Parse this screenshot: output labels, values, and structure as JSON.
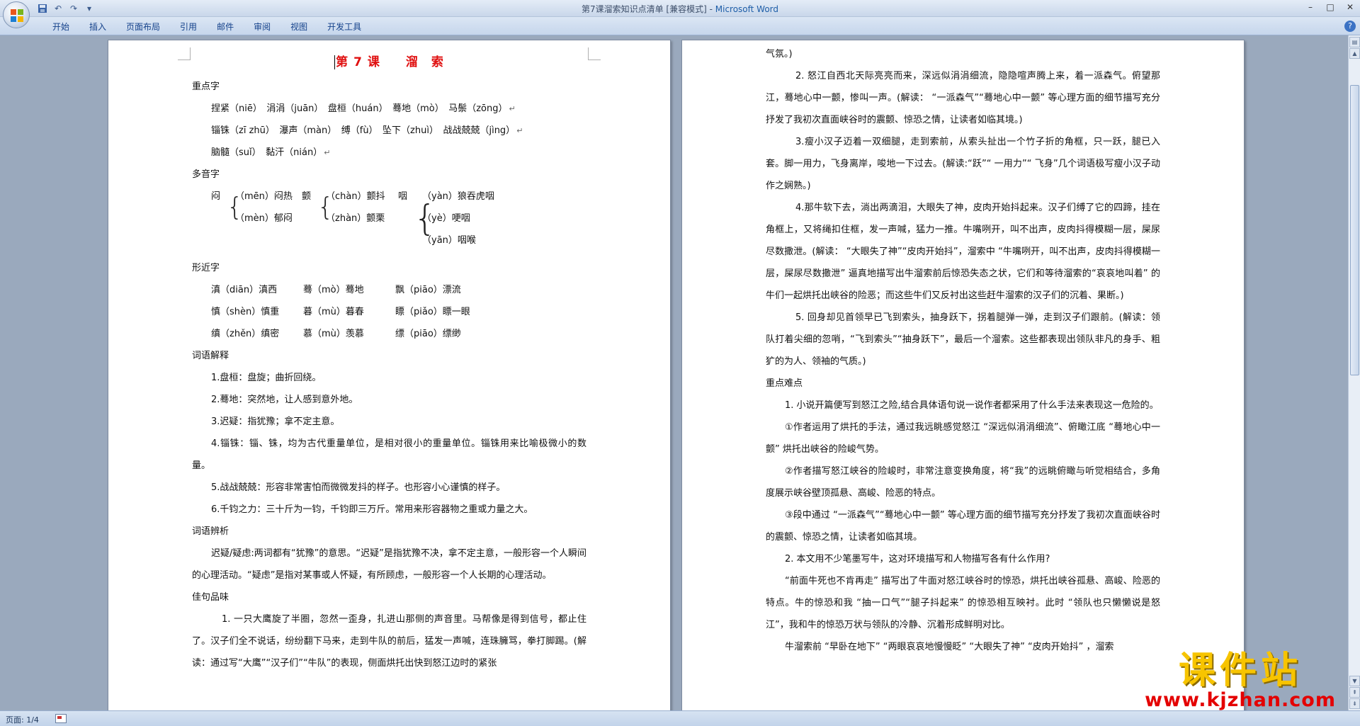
{
  "window": {
    "title_doc": "第7课溜索知识点清单 [兼容模式] - ",
    "title_app": "Microsoft Word"
  },
  "ribbon": {
    "tabs": [
      "开始",
      "插入",
      "页面布局",
      "引用",
      "邮件",
      "审阅",
      "视图",
      "开发工具"
    ]
  },
  "status": {
    "page": "页面: 1/4"
  },
  "watermark": {
    "cn": "课件站",
    "url": "www.kjzhan.com"
  },
  "page1": {
    "title": "第 7 课　　溜　索",
    "zhongdianzi_heading": "重点字",
    "zhongdianzi_lines": [
      "捏紧（niē）　涓涓（juān）　盘桓（huán）　蓦地（mò）　马鬃（zōng）",
      "锱铢（zī zhū）　瀑声（màn）　缚（fù）　坠下（zhuì）　战战兢兢（jìng）",
      "脑髓（suǐ）　黏汗（nián）"
    ],
    "duoyinzi_heading": "多音字",
    "duoyin": [
      {
        "ch": "闷",
        "items": [
          "（mēn）闷热",
          "（mèn）郁闷"
        ]
      },
      {
        "ch": "颤",
        "items": [
          "（chàn）颤抖",
          "（zhàn）颤栗"
        ]
      },
      {
        "ch": "咽",
        "items": [
          "（yàn）狼吞虎咽",
          "（yè）哽咽",
          "（yān）咽喉"
        ]
      }
    ],
    "xingjinzi_heading": "形近字",
    "xingjin_rows": [
      [
        "滇（diān）滇西",
        "蓦（mò）蓦地",
        "飘（piāo）漂流"
      ],
      [
        "慎（shèn）慎重",
        "暮（mù）暮春",
        "瞟（piǎo）瞟一眼"
      ],
      [
        "缜（zhěn）缜密",
        "慕（mù）羡慕",
        "缥（piāo）缥缈"
      ]
    ],
    "ciyu_heading": "词语解释",
    "ciyu_items": [
      "1.盘桓：盘旋；曲折回绕。",
      "2.蓦地：突然地，让人感到意外地。",
      "3.迟疑：指犹豫；拿不定主意。",
      "4.锱铢：锱、铢，均为古代重量单位，是相对很小的重量单位。锱铢用来比喻极微小的数量。",
      "5.战战兢兢：形容非常害怕而微微发抖的样子。也形容小心谨慎的样子。",
      "6.千钧之力：三十斤为一钧，千钧即三万斤。常用来形容器物之重或力量之大。"
    ],
    "bianxi_heading": "词语辨析",
    "bianxi_text": "迟疑/疑虑:两词都有“犹豫”的意思。“迟疑”是指犹豫不决，拿不定主意，一般形容一个人瞬间的心理活动。“疑虑”是指对某事或人怀疑，有所顾虑，一般形容一个人长期的心理活动。",
    "jiaju_heading": "佳句品味",
    "jiaju_text": "1. 一只大鹰旋了半圈，忽然一歪身，扎进山那侧的声音里。马帮像是得到信号，都止住了。汉子们全不说话，纷纷翻下马来，走到牛队的前后，猛发一声喊，连珠臃骂，拳打脚踢。(解读：通过写“大鹰”“汉子们”“牛队”的表现，侧面烘托出快到怒江边时的紧张"
  },
  "page2": {
    "lead": "气氛。)",
    "paras": [
      "2. 怒江自西北天际亮亮而来，深远似涓涓细流，隐隐喧声腾上来，着一派森气。俯望那江，蓦地心中一颤，惨叫一声。(解读： “一派森气”“蓦地心中一颤” 等心理方面的细节描写充分抒发了我初次直面峡谷时的震颤、惊恐之情，让读者如临其境。)",
      "3.瘦小汉子迈着一双细腿，走到索前，从索头扯出一个竹子折的角框，只一跃，腿已入套。脚一用力，飞身离岸，唆地一下过去。(解读:“跃”“ 一用力”“ 飞身”几个词语极写瘦小汉子动作之娴熟。)",
      "4.那牛软下去，淌出两滴泪，大眼失了神，皮肉开始抖起来。汉子们缚了它的四蹄，挂在角框上，又将绳扣住框，发一声喊，猛力一推。牛嘴咧开，叫不出声，皮肉抖得模糊一层，屎尿尽数撒泄。(解读： “大眼失了神”“皮肉开始抖”，溜索中 “牛嘴咧开，叫不出声，皮肉抖得模糊一层，屎尿尽数撒泄” 逼真地描写出牛溜索前后惊恐失态之状，它们和等待溜索的“哀哀地叫着” 的牛们一起烘托出峡谷的险恶；而这些牛们又反衬出这些赶牛溜索的汉子们的沉着、果断。)",
      "5. 回身却见首领早已飞到索头，抽身跃下，拐着腿弹一弹，走到汉子们跟前。(解读：领队打着尖细的忽哨，“飞到索头”“抽身跃下”，最后一个溜索。这些都表现出领队非凡的身手、粗犷的为人、领袖的气质。)"
    ],
    "zhongnan_heading": "重点难点",
    "zhongnan_q1": "1. 小说开篇便写到怒江之险,结合具体语句说一说作者都采用了什么手法来表现这一危险的。",
    "zhongnan_a1": [
      "①作者运用了烘托的手法，通过我远眺感觉怒江 “深远似涓涓细流”、俯瞰江底 “蓦地心中一颤” 烘托出峡谷的险峻气势。",
      "②作者描写怒江峡谷的险峻时，非常注意变换角度，将“我”的远眺俯瞰与听觉相结合，多角度展示峡谷壁顶孤悬、高峻、险恶的特点。",
      "③段中通过 “一派森气”“蓦地心中一颤” 等心理方面的细节描写充分抒发了我初次直面峡谷时的震颤、惊恐之情，让读者如临其境。"
    ],
    "zhongnan_q2": "2. 本文用不少笔墨写牛，这对环境描写和人物描写各有什么作用?",
    "zhongnan_a2": [
      "“前面牛死也不肯再走” 描写出了牛面对怒江峡谷时的惊恐，烘托出峡谷孤悬、高峻、险恶的特点。牛的惊恐和我 “抽一口气”“腿子抖起来” 的惊恐相互映衬。此时 “领队也只懒懒说是怒江”，我和牛的惊恐万状与领队的冷静、沉着形成鲜明对比。",
      "牛溜索前 “早卧在地下” “两眼哀哀地慢慢眨” “大眼失了神” “皮肉开始抖” ，溜索"
    ]
  }
}
